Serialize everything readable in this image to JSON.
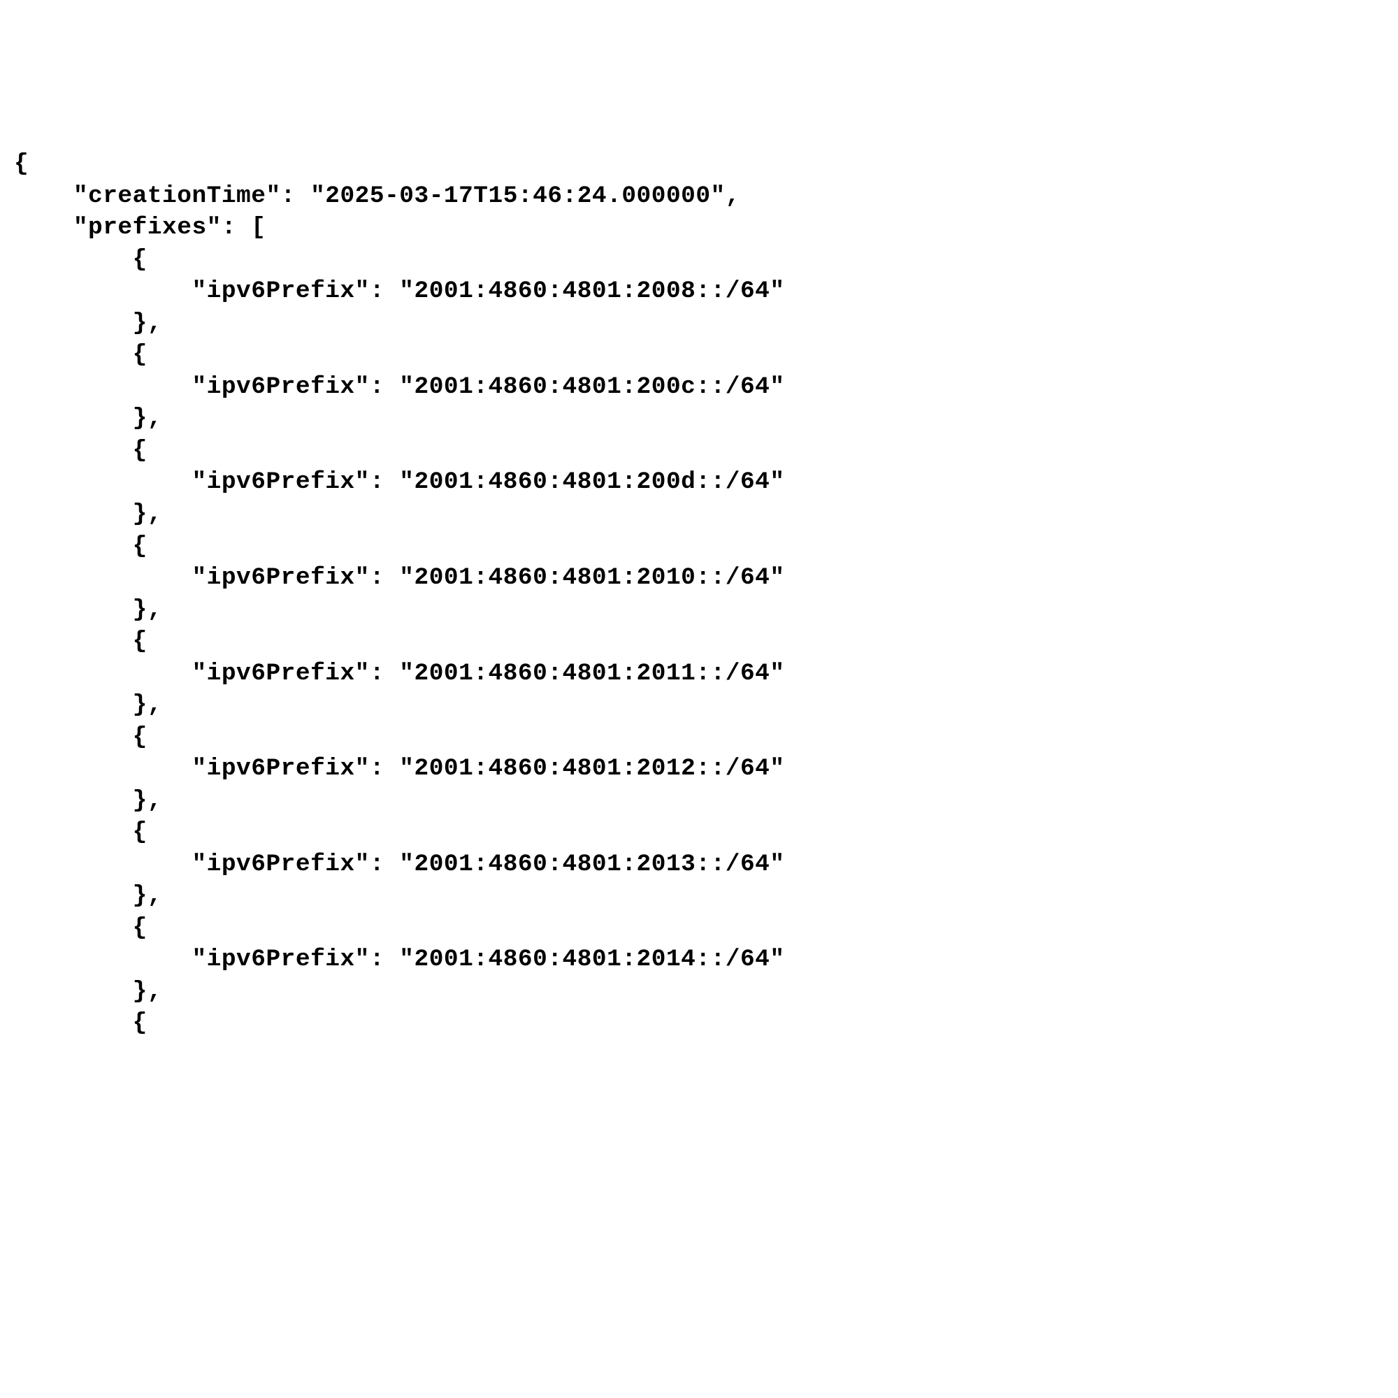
{
  "json": {
    "open_brace": "{",
    "creation_time_line": "    \"creationTime\": \"2025-03-17T15:46:24.000000\",",
    "prefixes_open": "    \"prefixes\": [",
    "item_open": "        {",
    "item_close_comma": "        },",
    "ipv6_key": "ipv6Prefix",
    "prefixes": [
      "2001:4860:4801:2008::/64",
      "2001:4860:4801:200c::/64",
      "2001:4860:4801:200d::/64",
      "2001:4860:4801:2010::/64",
      "2001:4860:4801:2011::/64",
      "2001:4860:4801:2012::/64",
      "2001:4860:4801:2013::/64",
      "2001:4860:4801:2014::/64"
    ]
  }
}
